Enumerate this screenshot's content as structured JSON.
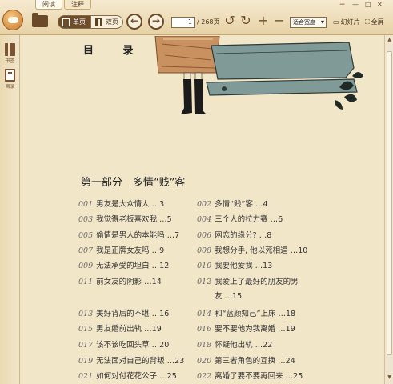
{
  "toolbar": {
    "tabs": [
      "阅读",
      "注释"
    ],
    "view_single": "单页",
    "view_double": "双页",
    "page_current": "1",
    "page_total": "/ 268页",
    "zoom": "适合宽度",
    "slideshow": "幻灯片",
    "fullscreen": "全屏"
  },
  "sidebar": {
    "items": [
      {
        "label": "书签",
        "icon": "bookmark-icon"
      },
      {
        "label": "目录",
        "icon": "contents-icon"
      }
    ]
  },
  "document": {
    "toc_title": "目  录",
    "part_heading": "第一部分　多情“贱”客",
    "left_column": [
      {
        "num": "001",
        "title": "男友是大众情人 …3"
      },
      {
        "num": "003",
        "title": "我觉得老板喜欢我 …5"
      },
      {
        "num": "005",
        "title": "偷情是男人的本能吗 …7"
      },
      {
        "num": "007",
        "title": "我是正牌女友吗 …9"
      },
      {
        "num": "009",
        "title": "无法承受的坦白 …12"
      },
      {
        "num": "011",
        "title": "前女友的阴影 …14"
      },
      {
        "num": "013",
        "title": "美好背后的不堪 …16"
      },
      {
        "num": "015",
        "title": "男友婚前出轨 …19"
      },
      {
        "num": "017",
        "title": "该不该吃回头草 …20"
      },
      {
        "num": "019",
        "title": "无法面对自己的背叛 …23"
      },
      {
        "num": "021",
        "title": "如何对付花花公子 …25"
      }
    ],
    "right_column": [
      {
        "num": "002",
        "title": "多情“贱”客 …4"
      },
      {
        "num": "004",
        "title": "三个人的拉力赛 …6"
      },
      {
        "num": "006",
        "title": "网恋的缘分? …8"
      },
      {
        "num": "008",
        "title": "我想分手, 他以死相逼 …10"
      },
      {
        "num": "010",
        "title": "我要他爱我 …13"
      },
      {
        "num": "012",
        "title": "我爱上了最好的朋友的男"
      },
      {
        "num": "",
        "title": "友 …15"
      },
      {
        "num": "014",
        "title": "和“蓝颜知己”上床 …18"
      },
      {
        "num": "016",
        "title": "要不要他为我离婚 …19"
      },
      {
        "num": "018",
        "title": "怀疑他出轨 …22"
      },
      {
        "num": "020",
        "title": "第三者角色的互换 …24"
      },
      {
        "num": "022",
        "title": "离婚了要不要再回来 …25"
      }
    ]
  },
  "colors": {
    "toolbar_bg": "#e9d6ab",
    "page_bg": "#f2e6c9",
    "accent_brown": "#6b4a2a",
    "illustration_teal": "#7f9a97"
  }
}
